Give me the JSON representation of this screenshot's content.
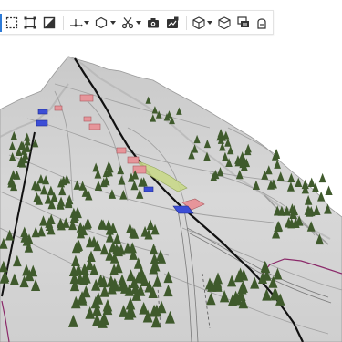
{
  "app": {
    "view": "3d-terrain-viewport"
  },
  "toolbar": {
    "tools": [
      {
        "id": "select-rectangle",
        "icon": "dashed-rectangle-icon",
        "has_menu": false
      },
      {
        "id": "select-nodes",
        "icon": "node-square-icon",
        "has_menu": false
      },
      {
        "id": "orthographic",
        "icon": "diagonal-square-icon",
        "has_menu": false
      },
      {
        "id": "axes",
        "icon": "axes-icon",
        "has_menu": true
      },
      {
        "id": "polygon",
        "icon": "hexagon-icon",
        "has_menu": true
      },
      {
        "id": "cut",
        "icon": "scissors-icon",
        "has_menu": true
      },
      {
        "id": "screenshot",
        "icon": "camera-icon",
        "has_menu": false
      },
      {
        "id": "export-image",
        "icon": "export-image-icon",
        "has_menu": false
      },
      {
        "id": "view-cube",
        "icon": "cube-icon",
        "has_menu": true
      },
      {
        "id": "view-box",
        "icon": "box-outline-icon",
        "has_menu": false
      },
      {
        "id": "layers",
        "icon": "layers-icon",
        "has_menu": false
      },
      {
        "id": "lock",
        "icon": "lock-icon",
        "has_menu": false
      }
    ],
    "accent_color": "#2d7ad6"
  },
  "scene": {
    "terrain_color": "#d6d6d6",
    "road_color": "#1a1a1a",
    "tree_color": "#3f5a2c",
    "building_colors": [
      "#e6959a",
      "#3c4ed6",
      "#c9d98a"
    ],
    "boundary_color": "#8b2a6a"
  }
}
